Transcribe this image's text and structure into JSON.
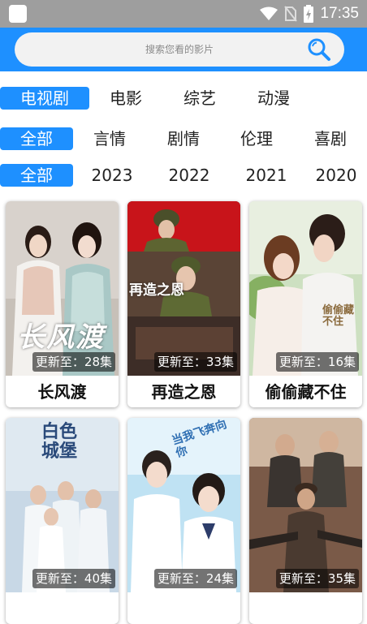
{
  "status_bar": {
    "time": "17:35"
  },
  "search": {
    "placeholder": "搜索您看的影片"
  },
  "category_tabs": [
    "电视剧",
    "电影",
    "综艺",
    "动漫"
  ],
  "genre_filters": [
    "全部",
    "言情",
    "剧情",
    "伦理",
    "喜剧"
  ],
  "year_filters": [
    "全部",
    "2023",
    "2022",
    "2021",
    "2020"
  ],
  "cards": [
    {
      "title": "长风渡",
      "badge": "更新至：28集",
      "poster_text": "长风渡"
    },
    {
      "title": "再造之恩",
      "badge": "更新至：33集",
      "poster_text": "再造之恩"
    },
    {
      "title": "偷偷藏不住",
      "badge": "更新至：16集",
      "poster_text": "偷偷藏不住"
    },
    {
      "title": "",
      "badge": "更新至：40集",
      "poster_text": "白色城堡"
    },
    {
      "title": "",
      "badge": "更新至：24集",
      "poster_text": "当我飞奔向你"
    },
    {
      "title": "",
      "badge": "更新至：35集",
      "poster_text": ""
    }
  ],
  "colors": {
    "accent": "#1e90ff",
    "status_bar": "#9e9e9e"
  }
}
